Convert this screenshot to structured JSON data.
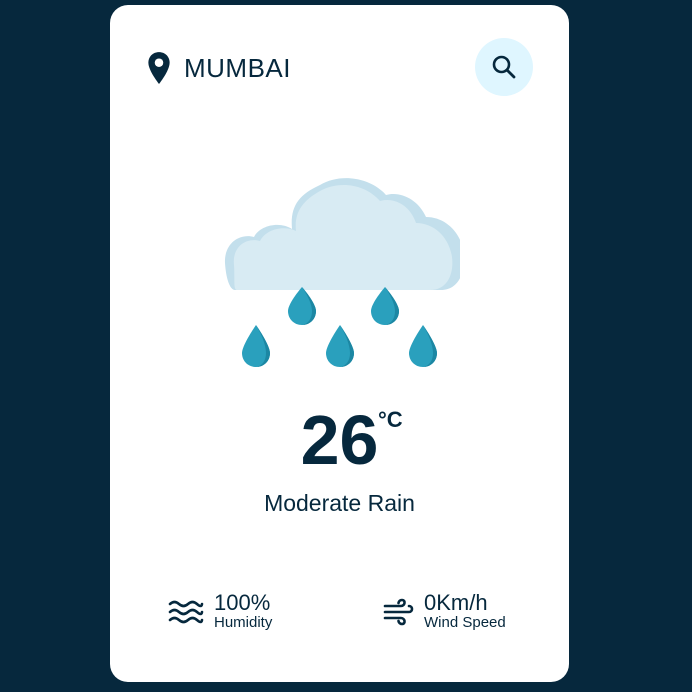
{
  "location": {
    "city": "MUMBAI"
  },
  "weather": {
    "temperature": "26",
    "unit": "°C",
    "description": "Moderate Rain"
  },
  "details": {
    "humidity_value": "100%",
    "humidity_label": "Humidity",
    "wind_value": "0Km/h",
    "wind_label": "Wind Speed"
  },
  "colors": {
    "background": "#06283d",
    "card": "#ffffff",
    "text": "#06283d",
    "search_bg": "#dff6ff",
    "cloud": "#d8ebf3",
    "cloud_shadow": "#c3dfec",
    "drop": "#2aa0bd",
    "drop_dark": "#1c87a3"
  },
  "icons": {
    "location": "location-pin-icon",
    "search": "search-icon",
    "weather": "rain-cloud-icon",
    "humidity": "waves-icon",
    "wind": "wind-icon"
  }
}
